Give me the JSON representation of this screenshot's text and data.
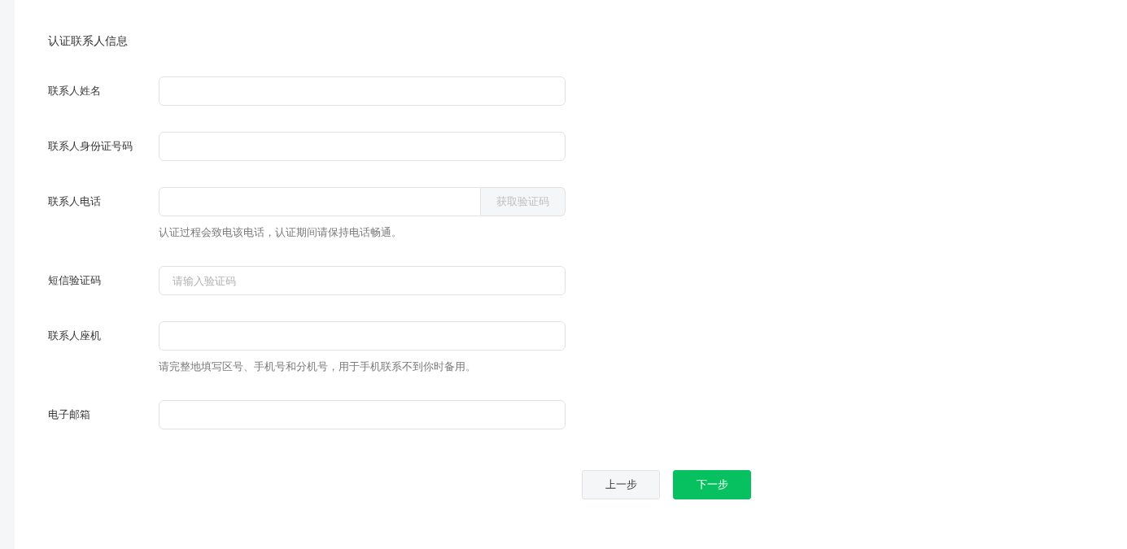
{
  "section_title": "认证联系人信息",
  "fields": [
    {
      "kind": "text",
      "label": "联系人姓名"
    },
    {
      "kind": "text",
      "label": "联系人身份证号码"
    },
    {
      "kind": "with-button",
      "label": "联系人电话",
      "button": {
        "label": "获取验证码",
        "disabled": true
      },
      "hint": "认证过程会致电该电话，认证期间请保持电话畅通。"
    },
    {
      "kind": "text",
      "label": "短信验证码",
      "placeholder": "请输入验证码"
    },
    {
      "kind": "text",
      "label": "联系人座机",
      "hint": "请完整地填写区号、手机号和分机号，用于手机联系不到你时备用。"
    },
    {
      "kind": "text",
      "label": "电子邮箱"
    }
  ],
  "buttons": [
    {
      "kind": "secondary",
      "label": "上一步"
    },
    {
      "kind": "primary",
      "label": "下一步"
    }
  ]
}
